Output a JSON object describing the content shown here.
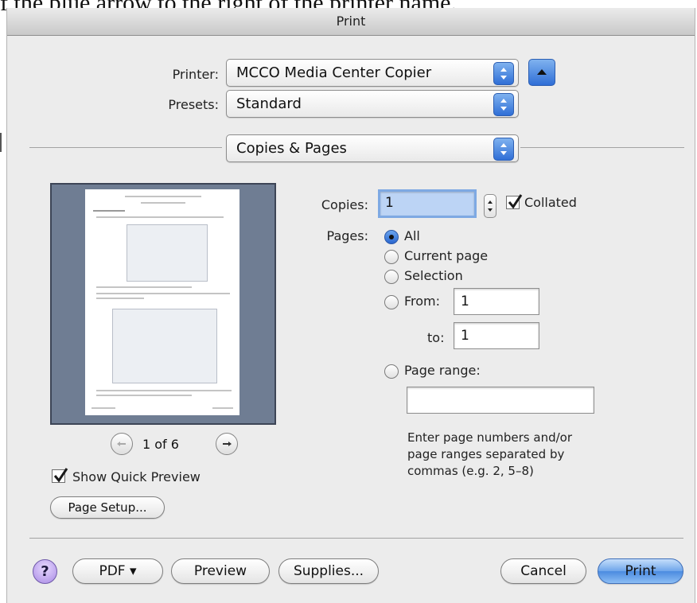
{
  "doc_snippet": "f the blue arrow to the right of the printer name.",
  "window": {
    "title": "Print"
  },
  "printer": {
    "label": "Printer:",
    "value": "MCCO Media Center Copier"
  },
  "presets": {
    "label": "Presets:",
    "value": "Standard"
  },
  "section_popup": {
    "value": "Copies & Pages"
  },
  "preview": {
    "page_indicator": "1 of 6",
    "show_quick_preview": "Show Quick Preview",
    "show_quick_preview_checked": true
  },
  "buttons": {
    "page_setup": "Page Setup...",
    "help": "?",
    "pdf": "PDF ▾",
    "preview": "Preview",
    "supplies": "Supplies...",
    "cancel": "Cancel",
    "print": "Print"
  },
  "copies": {
    "label": "Copies:",
    "value": "1",
    "collated_label": "Collated",
    "collated_checked": true
  },
  "pages": {
    "label": "Pages:",
    "options": [
      "All",
      "Current page",
      "Selection"
    ],
    "selected": "All",
    "from_label": "From:",
    "from_value": "1",
    "to_label": "to:",
    "to_value": "1",
    "page_range_label": "Page range:",
    "page_range_value": "",
    "help_lines": [
      "Enter page numbers and/or",
      "page ranges separated by",
      "commas (e.g. 2, 5–8)"
    ]
  },
  "colors": {
    "accent": "#3b7be0",
    "dialog_bg": "#ececec",
    "preview_bg": "#6f7d93"
  },
  "icons": {
    "popup_arrows": "updown-arrows-icon",
    "disclosure": "triangle-up-icon",
    "prev": "left-arrow-icon",
    "next": "right-arrow-icon",
    "check": "checkmark-icon"
  }
}
